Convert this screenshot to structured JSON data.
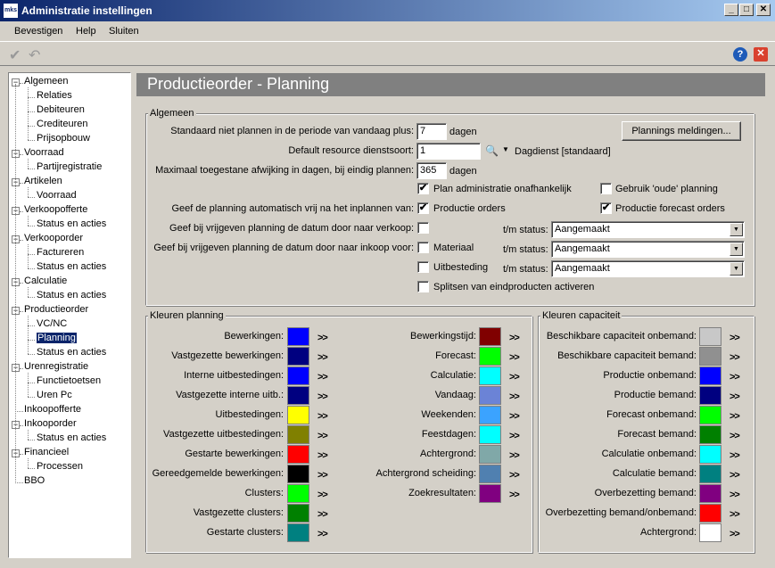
{
  "window": {
    "title": "Administratie instellingen",
    "app_icon": "mks",
    "min": "_",
    "max": "□",
    "close": "✕"
  },
  "menu": [
    "Bevestigen",
    "Help",
    "Sluiten"
  ],
  "toolbar": {
    "confirm_icon": "✔",
    "undo_icon": "↶",
    "help": "?",
    "close": "✕"
  },
  "tree": [
    {
      "label": "Algemeen",
      "level": 0,
      "expanded": true
    },
    {
      "label": "Relaties",
      "level": 1
    },
    {
      "label": "Debiteuren",
      "level": 1
    },
    {
      "label": "Crediteuren",
      "level": 1
    },
    {
      "label": "Prijsopbouw",
      "level": 1
    },
    {
      "label": "Voorraad",
      "level": 0,
      "expanded": true
    },
    {
      "label": "Partijregistratie",
      "level": 1
    },
    {
      "label": "Artikelen",
      "level": 0,
      "expanded": true
    },
    {
      "label": "Voorraad",
      "level": 1
    },
    {
      "label": "Verkoopofferte",
      "level": 0,
      "expanded": true
    },
    {
      "label": "Status en acties",
      "level": 1
    },
    {
      "label": "Verkooporder",
      "level": 0,
      "expanded": true
    },
    {
      "label": "Factureren",
      "level": 1
    },
    {
      "label": "Status en acties",
      "level": 1
    },
    {
      "label": "Calculatie",
      "level": 0,
      "expanded": true
    },
    {
      "label": "Status en acties",
      "level": 1
    },
    {
      "label": "Productieorder",
      "level": 0,
      "expanded": true
    },
    {
      "label": "VC/NC",
      "level": 1
    },
    {
      "label": "Planning",
      "level": 1,
      "selected": true
    },
    {
      "label": "Status en acties",
      "level": 1
    },
    {
      "label": "Urenregistratie",
      "level": 0,
      "expanded": true
    },
    {
      "label": "Functietoetsen",
      "level": 1
    },
    {
      "label": "Uren Pc",
      "level": 1
    },
    {
      "label": "Inkoopofferte",
      "level": 0
    },
    {
      "label": "Inkooporder",
      "level": 0,
      "expanded": true
    },
    {
      "label": "Status en acties",
      "level": 1
    },
    {
      "label": "Financieel",
      "level": 0,
      "expanded": true
    },
    {
      "label": "Processen",
      "level": 1
    },
    {
      "label": "BBO",
      "level": 0
    }
  ],
  "page_title": "Productieorder - Planning",
  "algemeen": {
    "title": "Algemeen",
    "row1_label": "Standaard niet plannen in de periode van vandaag plus:",
    "row1_value": "7",
    "row1_unit": "dagen",
    "plannings_button": "Plannings meldingen...",
    "row2_label": "Default resource dienstsoort:",
    "row2_value": "1",
    "row2_desc": "Dagdienst [standaard]",
    "row3_label": "Maximaal toegestane afwijking in dagen, bij eindig plannen:",
    "row3_value": "365",
    "row3_unit": "dagen",
    "cb_plan_admin": "Plan administratie onafhankelijk",
    "cb_plan_admin_checked": true,
    "cb_oude": "Gebruik 'oude' planning",
    "cb_oude_checked": false,
    "row5_label": "Geef de planning automatisch vrij na het inplannen van:",
    "cb_productie": "Productie orders",
    "cb_productie_checked": true,
    "cb_forecast": "Productie forecast orders",
    "cb_forecast_checked": true,
    "row6_label": "Geef bij vrijgeven planning de datum door naar verkoop:",
    "row6_checked": false,
    "row7_label": "Geef bij vrijgeven planning de datum door naar inkoop voor:",
    "cb_materiaal": "Materiaal",
    "cb_uitbesteding": "Uitbesteding",
    "cb_splitsen": "Splitsen van eindproducten activeren",
    "tm_status": "t/m status:",
    "status_values": [
      "Aangemaakt",
      "Aangemaakt",
      "Aangemaakt"
    ]
  },
  "kleuren_planning": {
    "title": "Kleuren planning",
    "left": [
      {
        "label": "Bewerkingen:",
        "color": "#0000ff"
      },
      {
        "label": "Vastgezette bewerkingen:",
        "color": "#000080"
      },
      {
        "label": "Interne uitbestedingen:",
        "color": "#0000ff"
      },
      {
        "label": "Vastgezette interne uitb.:",
        "color": "#000080"
      },
      {
        "label": "Uitbestedingen:",
        "color": "#ffff00"
      },
      {
        "label": "Vastgezette uitbestedingen:",
        "color": "#808000"
      },
      {
        "label": "Gestarte bewerkingen:",
        "color": "#ff0000"
      },
      {
        "label": "Gereedgemelde bewerkingen:",
        "color": "#000000"
      },
      {
        "label": "Clusters:",
        "color": "#00ff00"
      },
      {
        "label": "Vastgezette clusters:",
        "color": "#008000"
      },
      {
        "label": "Gestarte clusters:",
        "color": "#008080"
      }
    ],
    "right": [
      {
        "label": "Bewerkingstijd:",
        "color": "#800000"
      },
      {
        "label": "Forecast:",
        "color": "#00ff00"
      },
      {
        "label": "Calculatie:",
        "color": "#00ffff"
      },
      {
        "label": "Vandaag:",
        "color": "#6b83d6"
      },
      {
        "label": "Weekenden:",
        "color": "#3ba3ff"
      },
      {
        "label": "Feestdagen:",
        "color": "#00ffff"
      },
      {
        "label": "Achtergrond:",
        "color": "#80a8a8"
      },
      {
        "label": "Achtergrond scheiding:",
        "color": "#5080b0"
      },
      {
        "label": "Zoekresultaten:",
        "color": "#800080"
      }
    ]
  },
  "kleuren_capaciteit": {
    "title": "Kleuren capaciteit",
    "items": [
      {
        "label": "Beschikbare capaciteit onbemand:",
        "color": "#c8c8c8"
      },
      {
        "label": "Beschikbare capaciteit bemand:",
        "color": "#909090"
      },
      {
        "label": "Productie onbemand:",
        "color": "#0000ff"
      },
      {
        "label": "Productie bemand:",
        "color": "#000080"
      },
      {
        "label": "Forecast onbemand:",
        "color": "#00ff00"
      },
      {
        "label": "Forecast bemand:",
        "color": "#008000"
      },
      {
        "label": "Calculatie onbemand:",
        "color": "#00ffff"
      },
      {
        "label": "Calculatie bemand:",
        "color": "#008080"
      },
      {
        "label": "Overbezetting bemand:",
        "color": "#800080"
      },
      {
        "label": "Overbezetting bemand/onbemand:",
        "color": "#ff0000"
      },
      {
        "label": "Achtergrond:",
        "color": "#ffffff"
      }
    ]
  },
  "more_label": ">>"
}
